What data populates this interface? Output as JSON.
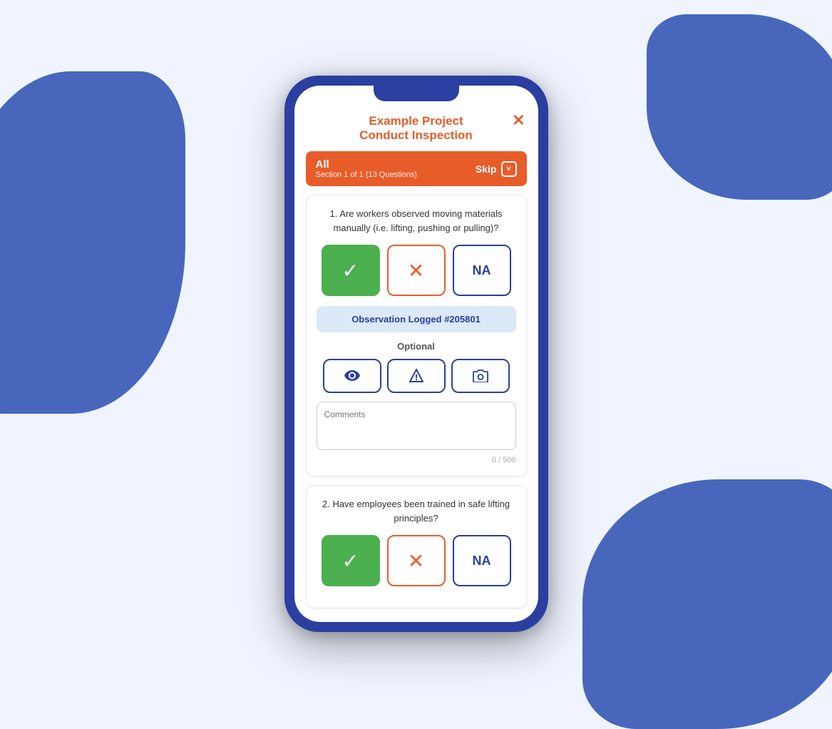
{
  "background": {
    "color": "#dce8ff"
  },
  "header": {
    "project_name": "Example Project",
    "title": "Conduct Inspection",
    "close_label": "✕"
  },
  "section_bar": {
    "title": "All",
    "subtitle": "Section 1 of 1 (13 Questions)",
    "skip_label": "Skip",
    "chevron": "˅"
  },
  "question1": {
    "number": "1.",
    "text": "Are workers observed moving materials manually (i.e. lifting, pushing or pulling)?",
    "yes_label": "✓",
    "no_label": "✕",
    "na_label": "NA",
    "observation": "Observation Logged #205801",
    "optional_label": "Optional",
    "char_count": "0 / 500",
    "comments_placeholder": "Comments"
  },
  "question2": {
    "number": "2.",
    "text": "Have employees been trained in safe lifting principles?",
    "yes_label": "✓",
    "no_label": "✕",
    "na_label": "NA"
  }
}
